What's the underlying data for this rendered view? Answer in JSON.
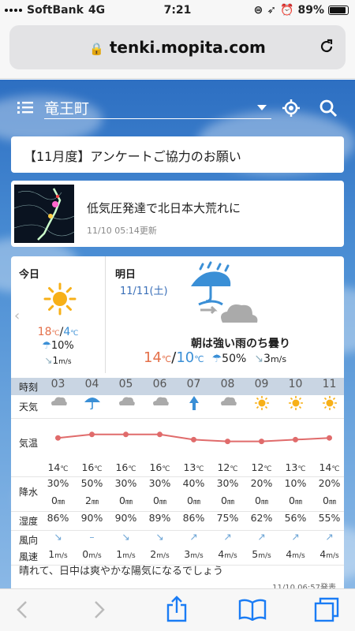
{
  "status": {
    "carrier": "SoftBank",
    "network": "4G",
    "time": "7:21",
    "battery": "89%"
  },
  "browser": {
    "url": "tenki.mopita.com"
  },
  "header": {
    "location": "竜王町"
  },
  "notice": {
    "text": "【11月度】アンケートご協力のお願い"
  },
  "news": {
    "title": "低気圧発達で北日本大荒れに",
    "date": "11/10 05:14更新"
  },
  "today": {
    "label": "今日",
    "hi": "18",
    "lo": "4",
    "rain": "10%",
    "wind": "1"
  },
  "tomorrow": {
    "label": "明日",
    "date": "11/11(土)",
    "desc": "朝は強い雨のち曇り",
    "hi": "14",
    "lo": "10",
    "rain": "50%",
    "wind": "3"
  },
  "table": {
    "labels": {
      "hour": "時刻",
      "weather": "天気",
      "temp": "気温",
      "precip": "降水",
      "humidity": "湿度",
      "wdir": "風向",
      "wspeed": "風速"
    },
    "hours": [
      "03",
      "04",
      "05",
      "06",
      "07",
      "08",
      "09",
      "10",
      "11"
    ],
    "weather": [
      "cloud",
      "umbrella",
      "cloud",
      "cloud",
      "rain-arrow",
      "cloud",
      "sun",
      "sun",
      "sun"
    ],
    "temps": [
      "14",
      "16",
      "16",
      "16",
      "13",
      "12",
      "12",
      "13",
      "14"
    ],
    "precip_pct": [
      "30%",
      "50%",
      "30%",
      "30%",
      "40%",
      "30%",
      "20%",
      "10%",
      "20%"
    ],
    "precip_mm": [
      "0",
      "2",
      "0",
      "0",
      "0",
      "0",
      "0",
      "0",
      "0"
    ],
    "humidity": [
      "86%",
      "90%",
      "90%",
      "89%",
      "86%",
      "75%",
      "62%",
      "56%",
      "55%"
    ],
    "wdir_arrows": [
      "↘",
      "–",
      "↘",
      "↘",
      "↗",
      "↗",
      "↗",
      "↗",
      "↗"
    ],
    "wspeed": [
      "1",
      "0",
      "1",
      "2",
      "3",
      "4",
      "5",
      "4",
      "4"
    ]
  },
  "units": {
    "c": "℃",
    "mm": "㎜",
    "ms": "m/s"
  },
  "summary": {
    "text": "晴れて、日中は爽やかな陽気になるでしょう",
    "issued": "11/10 06:57発表"
  }
}
